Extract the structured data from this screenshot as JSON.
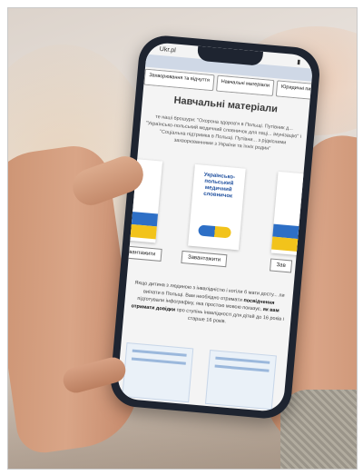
{
  "phone": {
    "status": {
      "left": "Ukr.pl",
      "right": "▮"
    },
    "tabs": [
      {
        "label": "Захворювання та відчуття"
      },
      {
        "label": "Навчальні матеріали"
      },
      {
        "label": "Юридичні пи"
      }
    ],
    "page_title": "Навчальні матеріали",
    "intro": "те наші брошури: \"Охорона здоров'я в Польщі. Путівник д... \"Українсько-польський медичний словничок для паці... імунізацію\" і \"Соціальна підтримка в Польщі. Путівни... з рідкісними захворюваннями з України та їхніх родин\"",
    "covers": [
      {
        "title": ""
      },
      {
        "title": "Українсько-польський медичний словничок"
      },
      {
        "title": ""
      }
    ],
    "download_label": "Завантажити",
    "download_label_right": "Зав",
    "body_text_1": "Якщо дитина з людиною з інвалідністю і котіли б мати досту... ли виїхати в Польщі. Вам необхідно отримати ",
    "body_text_bold_1": "посвідчення",
    "body_text_2": " підготували інфографіку, яка простою мовою показує, ",
    "body_text_bold_2": "як вам отримати довідки",
    "body_text_3": " про ступінь інвалідності для дітей до 16 років і старше 16 років."
  },
  "colors": {
    "ukraine_blue": "#2d6fc6",
    "ukraine_yellow": "#f2c31b",
    "title_gray": "#3a3a3a"
  }
}
